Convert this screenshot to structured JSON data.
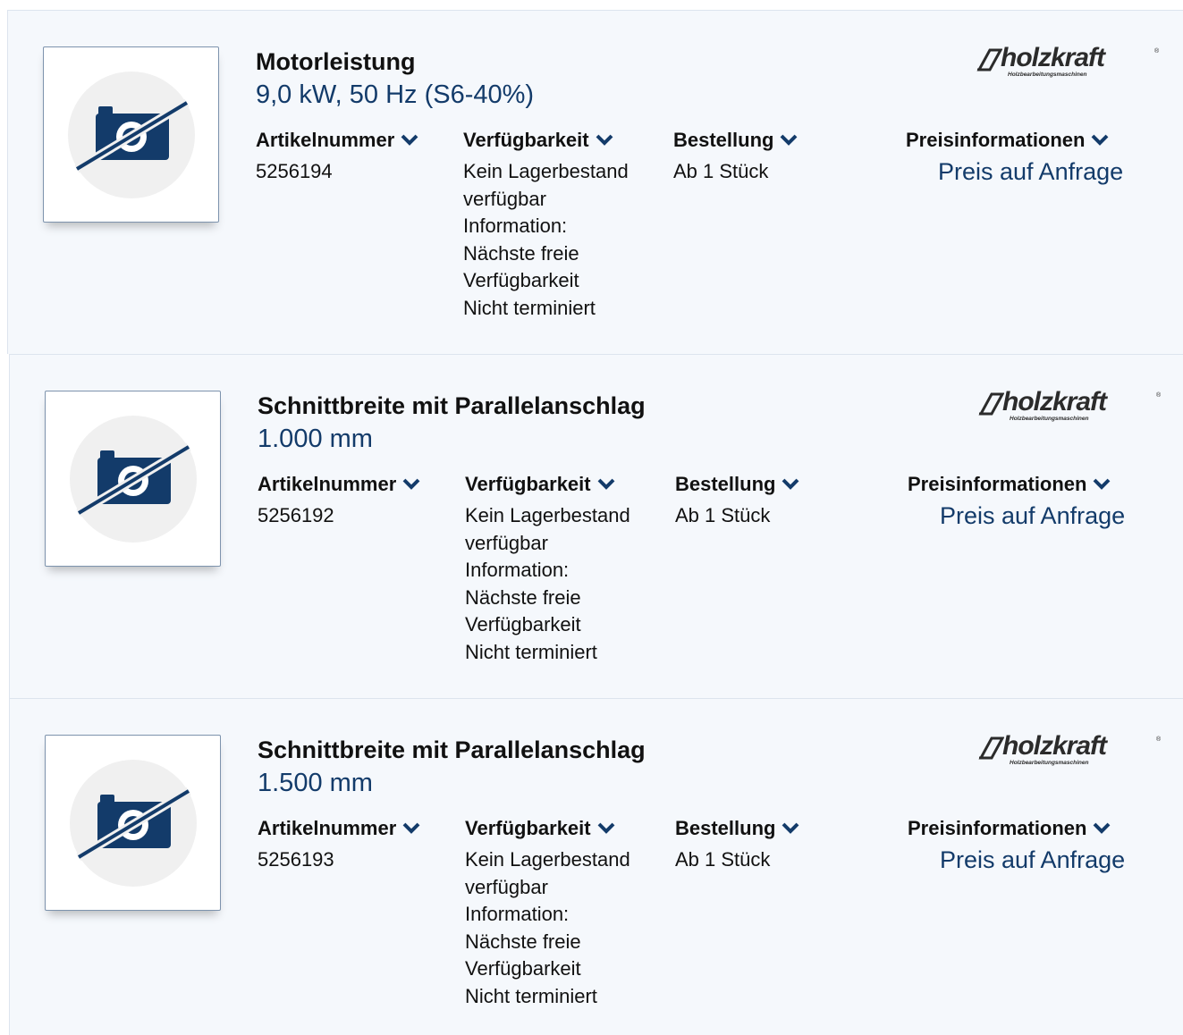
{
  "brand": {
    "name": "holzkraft",
    "tagline": "Holzbearbeitungsmaschinen",
    "registered": "®"
  },
  "colors": {
    "accent": "#133b6a",
    "card_bg": "#f5f8fc",
    "thumb_border": "#7d93ad",
    "placeholder_circle": "#f0f0f0"
  },
  "icons": {
    "image_placeholder": "no-camera-icon",
    "column_toggle": "chevron-down-icon"
  },
  "columns": {
    "article": "Artikelnummer",
    "availability": "Verfügbarkeit",
    "order": "Bestellung",
    "price": "Preisinformationen"
  },
  "products": [
    {
      "title": "Motorleistung",
      "subtitle": "9,0 kW, 50 Hz (S6-40%)",
      "article_number": "5256194",
      "availability": [
        "Kein Lagerbestand",
        "verfügbar",
        "Information:",
        "Nächste freie",
        "Verfügbarkeit",
        "Nicht terminiert"
      ],
      "order": "Ab 1 Stück",
      "price": "Preis auf Anfrage"
    },
    {
      "title": "Schnittbreite mit Parallelanschlag",
      "subtitle": "1.000 mm",
      "article_number": "5256192",
      "availability": [
        "Kein Lagerbestand",
        "verfügbar",
        "Information:",
        "Nächste freie",
        "Verfügbarkeit",
        "Nicht terminiert"
      ],
      "order": "Ab 1 Stück",
      "price": "Preis auf Anfrage"
    },
    {
      "title": "Schnittbreite mit Parallelanschlag",
      "subtitle": "1.500 mm",
      "article_number": "5256193",
      "availability": [
        "Kein Lagerbestand",
        "verfügbar",
        "Information:",
        "Nächste freie",
        "Verfügbarkeit",
        "Nicht terminiert"
      ],
      "order": "Ab 1 Stück",
      "price": "Preis auf Anfrage"
    }
  ]
}
